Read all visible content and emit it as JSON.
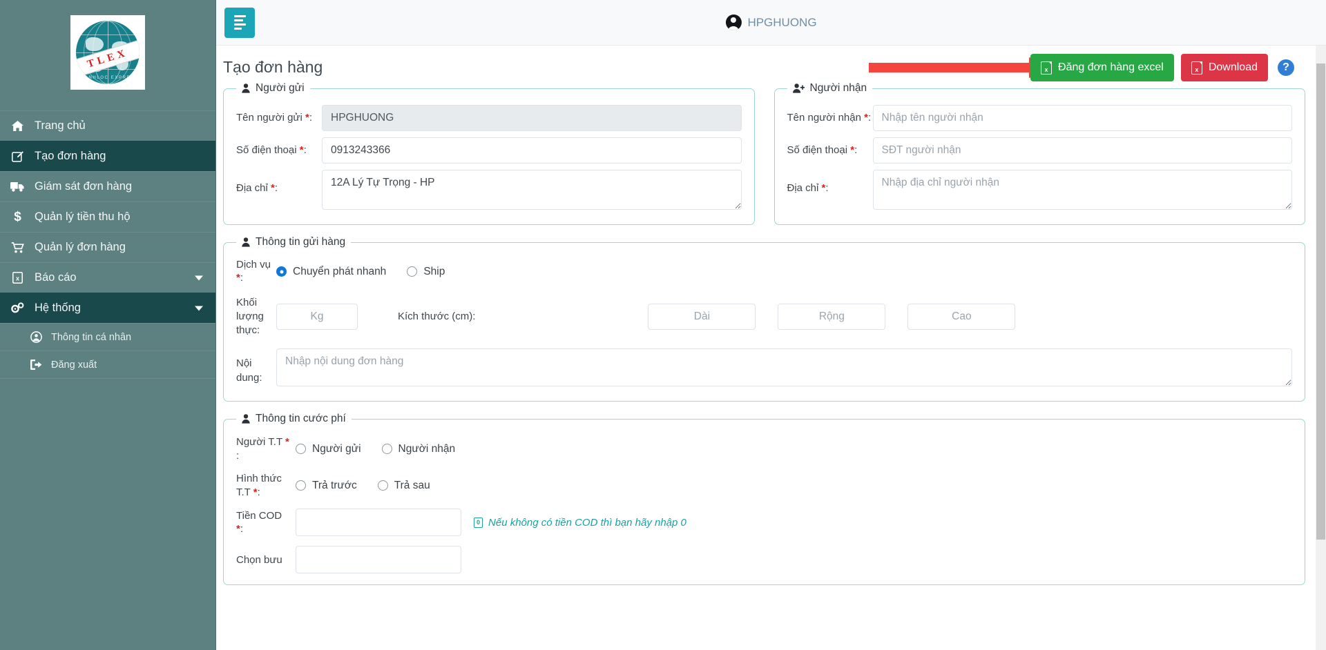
{
  "sidebar": {
    "logo": {
      "brand": "TLEX",
      "tagline": "THANHLOC EXPRESS"
    },
    "items": [
      {
        "label": "Trang chủ",
        "icon": "home-icon",
        "glyph": "⌂",
        "active": false,
        "caret": false
      },
      {
        "label": "Tạo đơn hàng",
        "icon": "edit-square-icon",
        "glyph": "✎",
        "active": true,
        "caret": false
      },
      {
        "label": "Giám sát đơn hàng",
        "icon": "truck-icon",
        "glyph": "⛟",
        "active": false,
        "caret": false
      },
      {
        "label": "Quản lý tiền thu hộ",
        "icon": "dollar-icon",
        "glyph": "$",
        "active": false,
        "caret": false
      },
      {
        "label": "Quản lý đơn hàng",
        "icon": "shopping-cart-icon",
        "glyph": "Ὥ2",
        "active": false,
        "caret": false
      },
      {
        "label": "Báo cáo",
        "icon": "excel-file-icon",
        "glyph": "x",
        "active": false,
        "caret": true
      },
      {
        "label": "Hệ thống",
        "icon": "gears-icon",
        "glyph": "⚙",
        "active": true,
        "caret": true
      }
    ],
    "subitems": [
      {
        "label": "Thông tin cá nhân",
        "icon": "user-circle-icon",
        "glyph": "●"
      },
      {
        "label": "Đăng xuất",
        "icon": "sign-out-icon",
        "glyph": "→"
      }
    ]
  },
  "topbar": {
    "menu_toggle": "menu-toggle-icon",
    "user": "HPGHUONG"
  },
  "page": {
    "title": "Tạo đơn hàng"
  },
  "actions": {
    "excel_upload": "Đăng đơn hàng excel",
    "download": "Download",
    "help": "?"
  },
  "sender": {
    "legend": "Người gửi",
    "name_label": "Tên người gửi",
    "name_value": "HPGHUONG",
    "phone_label": "Số điện thoại",
    "phone_value": "0913243366",
    "address_label": "Địa chỉ",
    "address_value": "12A Lý Tự Trọng - HP"
  },
  "receiver": {
    "legend": "Người nhận",
    "name_label": "Tên người nhận",
    "name_placeholder": "Nhập tên người nhận",
    "phone_label": "Số điện thoại",
    "phone_placeholder": "SĐT người nhận",
    "address_label": "Địa chỉ",
    "address_placeholder": "Nhập địa chỉ người nhận"
  },
  "shipping": {
    "legend": "Thông tin gửi hàng",
    "service_label": "Dịch vụ",
    "service_options": [
      {
        "label": "Chuyển phát nhanh",
        "selected": true
      },
      {
        "label": "Ship",
        "selected": false
      }
    ],
    "weight_label": "Khối lượng thực:",
    "weight_placeholder": "Kg",
    "size_label": "Kích thước (cm):",
    "length_placeholder": "Dài",
    "width_placeholder": "Rộng",
    "height_placeholder": "Cao",
    "content_label": "Nội dung:",
    "content_placeholder": "Nhập nội dung đơn hàng"
  },
  "fees": {
    "legend": "Thông tin cước phí",
    "payer_label": "Người T.T",
    "payer_options": [
      {
        "label": "Người gửi",
        "selected": false
      },
      {
        "label": "Người nhận",
        "selected": false
      }
    ],
    "method_label": "Hình thức T.T",
    "method_options": [
      {
        "label": "Trả trước",
        "selected": false
      },
      {
        "label": "Trả sau",
        "selected": false
      }
    ],
    "cod_label": "Tiền COD",
    "cod_value": "",
    "cod_hint": "Nếu không có tiền COD thì bạn hãy nhập 0",
    "cod_hint_badge": "0",
    "post_office_label": "Chọn bưu"
  },
  "colors": {
    "sidebar": "#5d8080",
    "sidebar_active": "#19494b",
    "accent_teal": "#1ba6b8",
    "fieldset_border": "#9ed6d6",
    "green": "#28a745",
    "red": "#dc3545",
    "blue_help": "#2f7fd4",
    "annotation_arrow": "#f4453f",
    "radio_on": "#1378d4",
    "hint_teal": "#17a2a2"
  }
}
